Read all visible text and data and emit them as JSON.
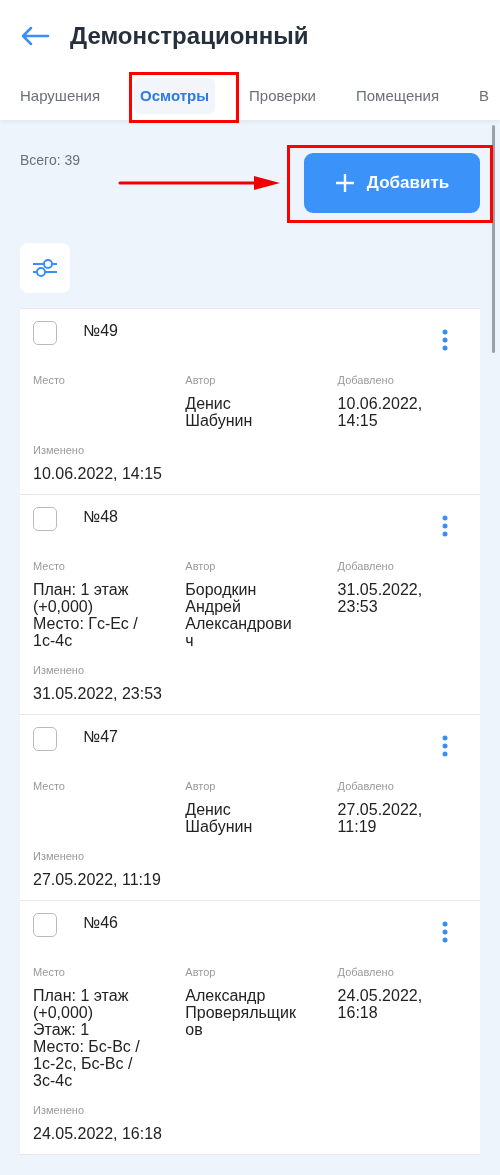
{
  "header": {
    "title": "Демонстрационный"
  },
  "tabs": [
    {
      "label": "Нарушения",
      "selected": false
    },
    {
      "label": "Осмотры",
      "selected": true
    },
    {
      "label": "Проверки",
      "selected": false
    },
    {
      "label": "Помещения",
      "selected": false
    },
    {
      "label": "В",
      "selected": false
    }
  ],
  "total": "Всего: 39",
  "add_button": {
    "label": "Добавить"
  },
  "cards": [
    {
      "number": "№49",
      "checked": false,
      "fields": [
        {
          "label": "Место"
        },
        {
          "label": "Автор",
          "value": [
            "Денис Шабунин"
          ]
        },
        {
          "label": "Добавлено",
          "value": [
            "10.06.2022, 14:15"
          ]
        }
      ],
      "changed": {
        "label": "Изменено",
        "value": "10.06.2022, 14:15"
      }
    },
    {
      "number": "№48",
      "checked": false,
      "fields": [
        {
          "label": "Место",
          "value": [
            "План: 1 этаж (+0,000)",
            "Место: Гс-Ес / 1с-4с"
          ]
        },
        {
          "label": "Автор",
          "value": [
            "Бородкин Андрей Александрович"
          ]
        },
        {
          "label": "Добавлено",
          "value": [
            "31.05.2022, 23:53"
          ]
        }
      ],
      "changed": {
        "label": "Изменено",
        "value": "31.05.2022, 23:53"
      }
    },
    {
      "number": "№47",
      "checked": false,
      "fields": [
        {
          "label": "Место"
        },
        {
          "label": "Автор",
          "value": [
            "Денис Шабунин"
          ]
        },
        {
          "label": "Добавлено",
          "value": [
            "27.05.2022, 11:19"
          ]
        }
      ],
      "changed": {
        "label": "Изменено",
        "value": "27.05.2022, 11:19"
      }
    },
    {
      "number": "№46",
      "checked": false,
      "fields": [
        {
          "label": "Место",
          "value": [
            "План: 1 этаж (+0,000)",
            "Этаж: 1",
            "Место: Бс-Вс / 1с-2с, Бс-Вс / 3с-4с"
          ]
        },
        {
          "label": "Автор",
          "value": [
            "Александр Проверяльщиков"
          ]
        },
        {
          "label": "Добавлено",
          "value": [
            "24.05.2022, 16:18"
          ]
        }
      ],
      "changed": {
        "label": "Изменено",
        "value": "24.05.2022, 16:18"
      }
    }
  ]
}
